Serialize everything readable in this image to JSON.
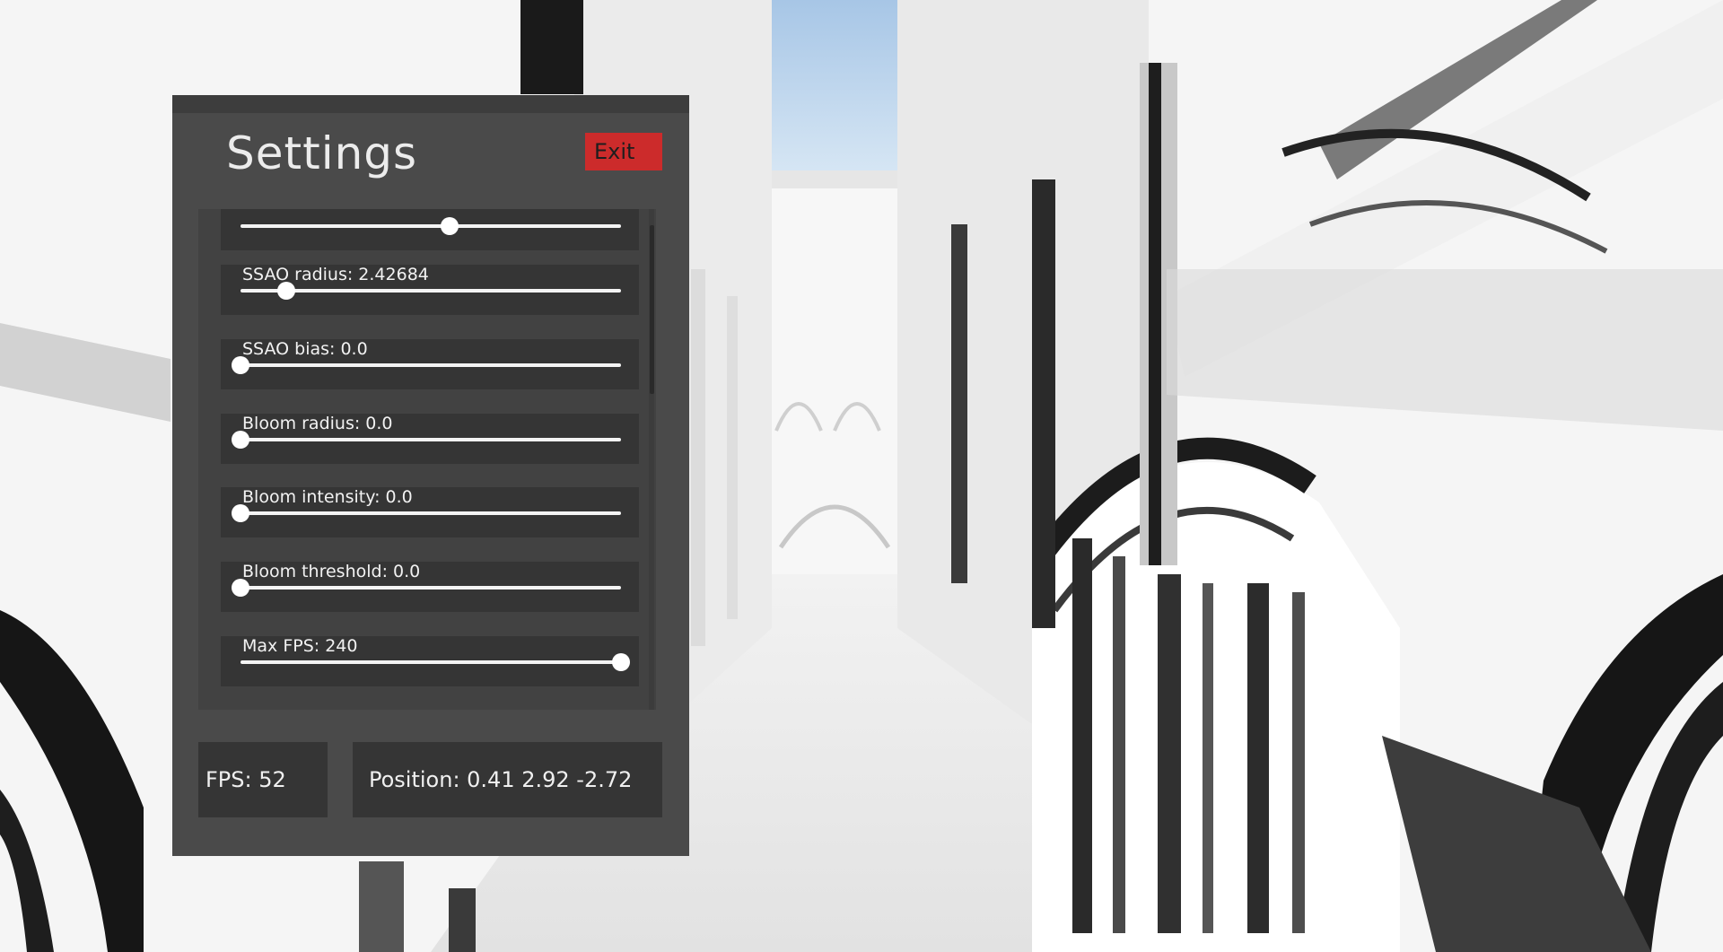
{
  "settings_panel": {
    "title": "Settings",
    "exit_label": "Exit",
    "sliders": [
      {
        "label": "",
        "value_fraction": 0.55
      },
      {
        "label": "SSAO radius: 2.42684",
        "value_fraction": 0.12
      },
      {
        "label": "SSAO bias: 0.0",
        "value_fraction": 0.0
      },
      {
        "label": "Bloom radius: 0.0",
        "value_fraction": 0.0
      },
      {
        "label": "Bloom intensity: 0.0",
        "value_fraction": 0.0
      },
      {
        "label": "Bloom threshold: 0.0",
        "value_fraction": 0.0
      },
      {
        "label": "Max FPS: 240",
        "value_fraction": 1.0
      }
    ],
    "scroll_fraction": 0.35
  },
  "status": {
    "fps": "FPS: 52",
    "position": "Position: 0.41 2.92 -2.72"
  },
  "colors": {
    "panel_bg": "#4a4a4a",
    "row_bg": "#353535",
    "exit_red": "#cc2b2b",
    "sky": "#b6d0ea"
  }
}
